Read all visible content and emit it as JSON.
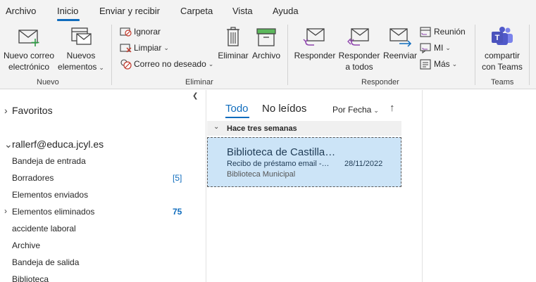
{
  "tabs": [
    "Archivo",
    "Inicio",
    "Enviar y recibir",
    "Carpeta",
    "Vista",
    "Ayuda"
  ],
  "ribbon": {
    "nuevo": {
      "new_email": [
        "Nuevo correo",
        "electrónico"
      ],
      "new_items": [
        "Nuevos",
        "elementos"
      ],
      "group_label": "Nuevo"
    },
    "eliminar": {
      "ignore": "Ignorar",
      "clean": "Limpiar",
      "junk": "Correo no deseado",
      "delete": "Eliminar",
      "archive": "Archivo",
      "group_label": "Eliminar"
    },
    "responder": {
      "reply": "Responder",
      "reply_all": [
        "Responder",
        "a todos"
      ],
      "forward": "Reenviar",
      "meeting": "Reunión",
      "im": "MI",
      "more": "Más",
      "group_label": "Responder"
    },
    "teams": {
      "share": [
        "compartir",
        "con Teams"
      ],
      "group_label": "Teams"
    }
  },
  "folders": {
    "favorites": "Favoritos",
    "account": "rallerf@educa.jcyl.es",
    "items": [
      {
        "label": "Bandeja de entrada",
        "count": ""
      },
      {
        "label": "Borradores",
        "count": "[5]"
      },
      {
        "label": "Elementos enviados",
        "count": ""
      },
      {
        "label": "Elementos eliminados",
        "count": "75"
      },
      {
        "label": "accidente laboral",
        "count": ""
      },
      {
        "label": "Archive",
        "count": ""
      },
      {
        "label": "Bandeja de salida",
        "count": ""
      },
      {
        "label": "Biblioteca",
        "count": ""
      }
    ]
  },
  "list": {
    "filter_all": "Todo",
    "filter_unread": "No leídos",
    "sort": "Por Fecha",
    "group_header": "Hace tres semanas",
    "messages": [
      {
        "sender": "Biblioteca de Castilla…",
        "subject": "Recibo de préstamo email -…",
        "date": "28/11/2022",
        "preview": "Biblioteca Municipal"
      }
    ]
  },
  "colors": {
    "accent": "#0f6cbd",
    "selected_row": "#cce4f7",
    "ribbon_bg": "#f3f3f3"
  }
}
